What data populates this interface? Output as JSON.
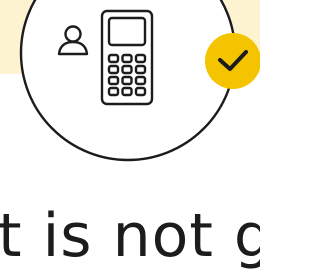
{
  "theme": {
    "background": "#ffffff",
    "highlight_band": "#fdf3d1",
    "line_color": "#1c1c1c",
    "check_badge": "#f5c400",
    "text_color": "#1c1c1c"
  },
  "illustration": {
    "icons": [
      "person-icon",
      "calculator-icon",
      "checkmark-badge-icon"
    ]
  },
  "caption": {
    "text": "t is not go"
  }
}
